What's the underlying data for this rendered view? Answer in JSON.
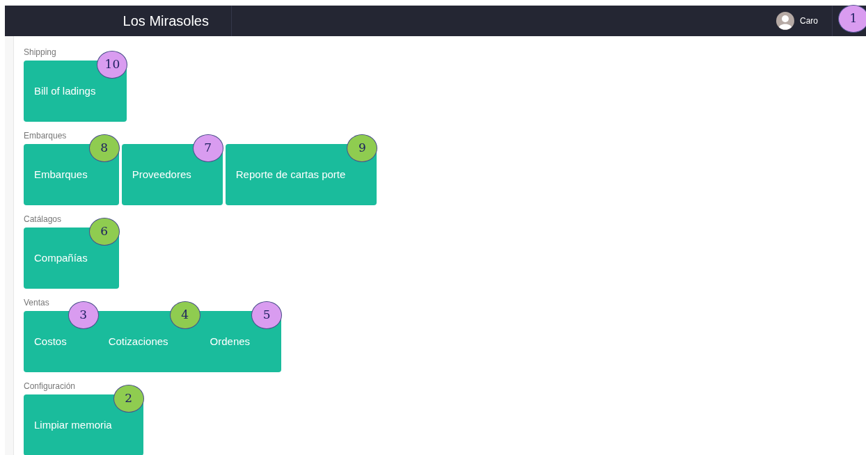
{
  "navbar": {
    "brand": "Los Mirasoles",
    "user": "Caro",
    "marker": {
      "number": "1",
      "color": "#d99cf0"
    }
  },
  "sections": [
    {
      "label": "Shipping",
      "tiles": [
        {
          "items": [
            {
              "label": "Bill of ladings",
              "marker": {
                "number": "10",
                "color": "#d99cf0"
              }
            }
          ]
        }
      ]
    },
    {
      "label": "Embarques",
      "tiles": [
        {
          "items": [
            {
              "label": "Embarques",
              "marker": {
                "number": "8",
                "color": "#8fcc50"
              }
            }
          ]
        },
        {
          "items": [
            {
              "label": "Proveedores",
              "marker": {
                "number": "7",
                "color": "#d99cf0"
              }
            }
          ]
        },
        {
          "items": [
            {
              "label": "Reporte de cartas porte",
              "marker": {
                "number": "9",
                "color": "#8fcc50"
              }
            }
          ]
        }
      ]
    },
    {
      "label": "Catálagos",
      "tiles": [
        {
          "items": [
            {
              "label": "Compañías",
              "marker": {
                "number": "6",
                "color": "#8fcc50"
              }
            }
          ]
        }
      ]
    },
    {
      "label": "Ventas",
      "tiles": [
        {
          "items": [
            {
              "label": "Costos",
              "marker": {
                "number": "3",
                "color": "#d99cf0"
              }
            },
            {
              "label": "Cotizaciones",
              "marker": {
                "number": "4",
                "color": "#8fcc50"
              }
            },
            {
              "label": "Ordenes",
              "marker": {
                "number": "5",
                "color": "#d99cf0"
              }
            }
          ]
        }
      ]
    },
    {
      "label": "Configuración",
      "tiles": [
        {
          "items": [
            {
              "label": "Limpiar memoria",
              "marker": {
                "number": "2",
                "color": "#8fcc50"
              }
            }
          ]
        }
      ]
    }
  ]
}
